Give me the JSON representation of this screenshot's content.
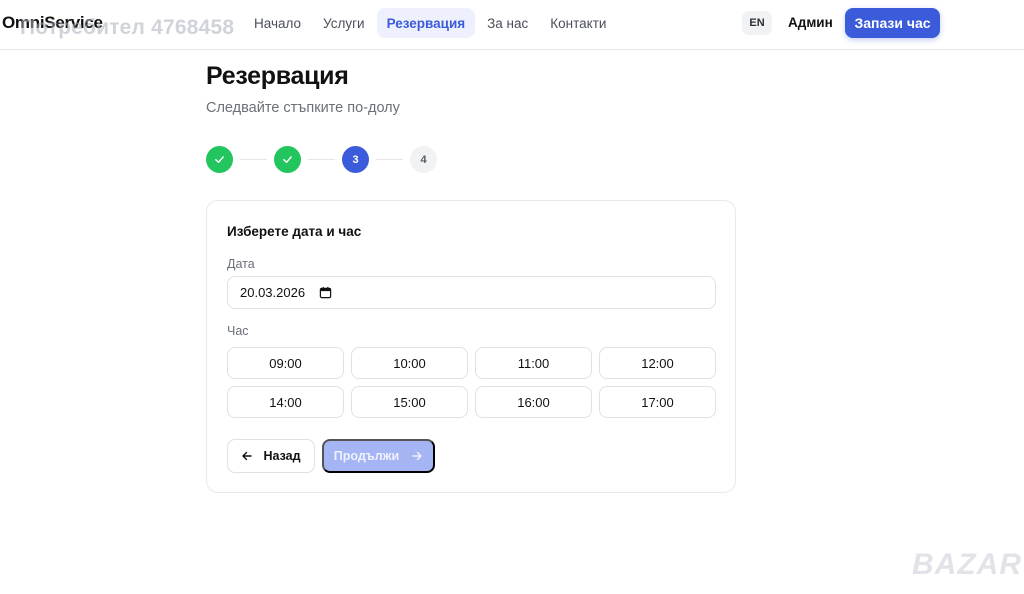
{
  "header": {
    "logo": "OmniService",
    "user_watermark": "Потребител 4768458",
    "nav": [
      {
        "label": "Начало",
        "active": false
      },
      {
        "label": "Услуги",
        "active": false
      },
      {
        "label": "Резервация",
        "active": true
      },
      {
        "label": "За нас",
        "active": false
      },
      {
        "label": "Контакти",
        "active": false
      }
    ],
    "lang": "EN",
    "admin_label": "Админ",
    "book_label": "Запази час"
  },
  "page": {
    "title": "Резервация",
    "subtitle": "Следвайте стъпките по-долу"
  },
  "stepper": {
    "steps": [
      {
        "label": "✓",
        "state": "done"
      },
      {
        "label": "✓",
        "state": "done"
      },
      {
        "label": "3",
        "state": "current"
      },
      {
        "label": "4",
        "state": "todo"
      }
    ]
  },
  "form": {
    "title": "Изберете дата и час",
    "date_label": "Дата",
    "date_value": "20.03.2026",
    "time_label": "Час",
    "slots": [
      "09:00",
      "10:00",
      "11:00",
      "12:00",
      "14:00",
      "15:00",
      "16:00",
      "17:00"
    ],
    "back_label": "Назад",
    "next_label": "Продължи"
  },
  "watermark": "BAZAR",
  "colors": {
    "primary": "#3b5bdb",
    "success": "#22c55e",
    "disabled_primary": "#a5b4f3"
  }
}
